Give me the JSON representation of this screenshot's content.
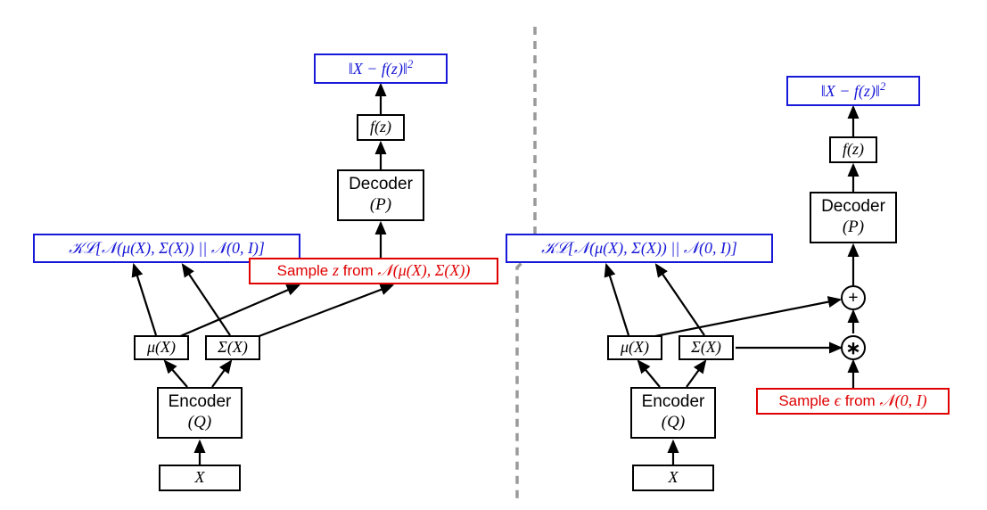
{
  "left": {
    "x_label": "X",
    "encoder": {
      "line1": "Encoder",
      "line2": "(Q)"
    },
    "mu": "μ(X)",
    "sigma": "Σ(X)",
    "kl": "𝒦ℒ[𝒩(μ(X), Σ(X)) || 𝒩(0, I)]",
    "sample_z_prefix": "Sample ",
    "sample_z_var": "z",
    "sample_z_mid": " from ",
    "sample_z_dist": "𝒩(μ(X), Σ(X))",
    "decoder": {
      "line1": "Decoder",
      "line2": "(P)"
    },
    "fz": "f(z)",
    "loss": "‖X − f(z)‖²"
  },
  "right": {
    "x_label": "X",
    "encoder": {
      "line1": "Encoder",
      "line2": "(Q)"
    },
    "mu": "μ(X)",
    "sigma": "Σ(X)",
    "kl": "𝒦ℒ[𝒩(μ(X), Σ(X)) || 𝒩(0, I)]",
    "sample_eps_prefix": "Sample ",
    "sample_eps_var": "ϵ",
    "sample_eps_mid": " from ",
    "sample_eps_dist": "𝒩(0, I)",
    "decoder": {
      "line1": "Decoder",
      "line2": "(P)"
    },
    "fz": "f(z)",
    "loss": "‖X − f(z)‖²",
    "plus": "+",
    "times": "∗"
  }
}
